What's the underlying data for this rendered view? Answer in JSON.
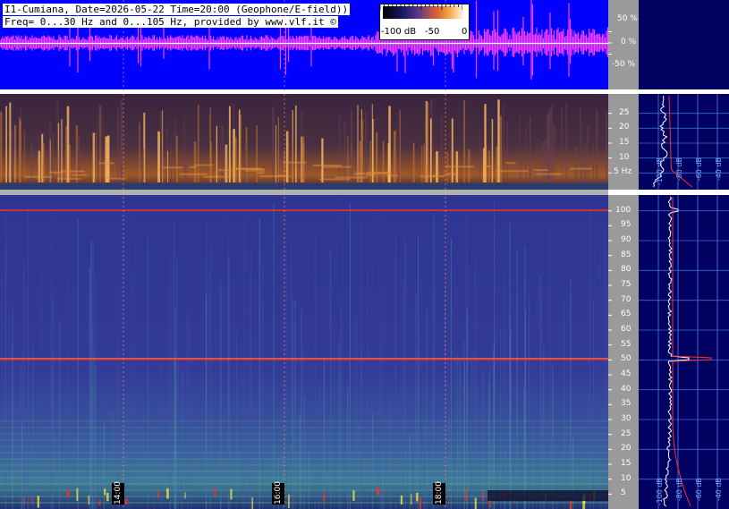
{
  "header": {
    "line1": "I1-Cumiana, Date=2026-05-22 Time=20:00 (Geophone/E-field))",
    "line2": "Freq= 0...30 Hz and 0...105 Hz, provided by www.vlf.it ©"
  },
  "colorbar": {
    "labels": [
      "-100 dB",
      "-50",
      "0"
    ]
  },
  "waveform_axis": {
    "labels": [
      "50 %",
      "0 %",
      "-50 %"
    ]
  },
  "low_spectrogram_axis": {
    "labels": [
      "25",
      "20",
      "15",
      "10",
      "5 Hz"
    ]
  },
  "high_spectrogram_axis": {
    "labels": [
      "100",
      "95",
      "90",
      "85",
      "80",
      "75",
      "70",
      "65",
      "60",
      "55",
      "50",
      "45",
      "40",
      "35",
      "30",
      "25",
      "20",
      "15",
      "10",
      "5"
    ]
  },
  "time_markers": [
    "14:00",
    "16:00",
    "18:00"
  ],
  "spectrum_panel_labels": {
    "top": [
      "-100 dB",
      "-80 dB",
      "-60 dB",
      "-40 dB"
    ],
    "bottom": [
      "-100 dB",
      "-80 dB",
      "-60 dB",
      "-40 dB"
    ]
  },
  "colors": {
    "waveform_bg": "#0000ff",
    "waveform_trace": "#ff40ff",
    "low_spectro_bg": "#2a1a3a",
    "high_spectro_bg": "#2e3590",
    "axis_bg": "#9a9a9a",
    "panel_bg": "#000060",
    "line_50hz": "#ff3020"
  }
}
